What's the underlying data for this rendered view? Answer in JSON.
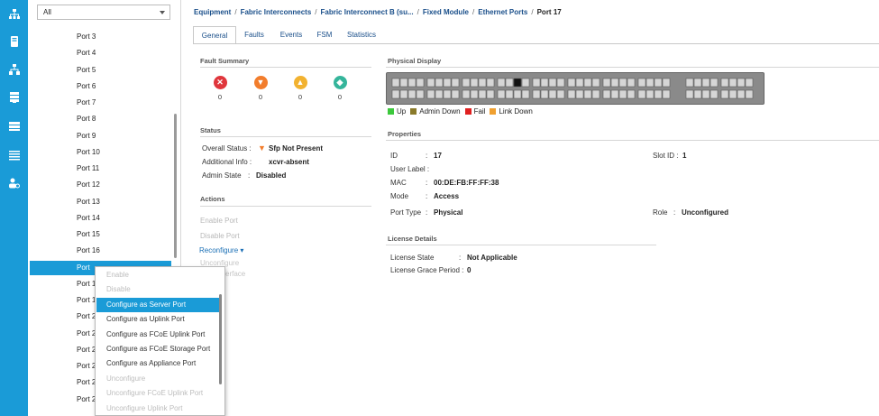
{
  "rail": {
    "items": [
      {
        "icon": "network-icon"
      },
      {
        "icon": "server-icon"
      },
      {
        "icon": "lan-icon"
      },
      {
        "icon": "storage-icon"
      },
      {
        "icon": "chassis-icon"
      },
      {
        "icon": "list-icon"
      },
      {
        "icon": "admin-icon"
      }
    ]
  },
  "tree": {
    "filter": "All",
    "ports": [
      "Port 3",
      "Port 4",
      "Port 5",
      "Port 6",
      "Port 7",
      "Port 8",
      "Port 9",
      "Port 10",
      "Port 11",
      "Port 12",
      "Port 13",
      "Port 14",
      "Port 15",
      "Port 16",
      "Port",
      "Port 1",
      "Port 1",
      "Port 2",
      "Port 2",
      "Port 2",
      "Port 2",
      "Port 2",
      "Port 2"
    ],
    "selected_index": 14
  },
  "breadcrumb": {
    "items": [
      "Equipment",
      "Fabric Interconnects",
      "Fabric Interconnect B (su...",
      "Fixed Module",
      "Ethernet Ports"
    ],
    "current": "Port 17",
    "separator": "/"
  },
  "tabs": [
    "General",
    "Faults",
    "Events",
    "FSM",
    "Statistics"
  ],
  "active_tab": "General",
  "fault_summary": {
    "title": "Fault Summary",
    "items": [
      {
        "icon": "critical-icon",
        "color": "#e0363c",
        "count": "0"
      },
      {
        "icon": "major-icon",
        "color": "#f27d2c",
        "count": "0"
      },
      {
        "icon": "minor-icon",
        "color": "#f2b230",
        "count": "0"
      },
      {
        "icon": "warning-icon",
        "color": "#35b59b",
        "count": "0"
      }
    ]
  },
  "status": {
    "title": "Status",
    "overall_label": "Overall Status :",
    "overall_value": "Sfp Not Present",
    "info_label": "Additional Info :",
    "info_value": "xcvr-absent",
    "admin_label": "Admin State",
    "admin_sep": ":",
    "admin_value": "Disabled"
  },
  "actions": {
    "title": "Actions",
    "enable": "Enable Port",
    "disable": "Disable Port",
    "reconfigure": "Reconfigure",
    "unconfigure": "Unconfigure",
    "interface_fragment": "erface"
  },
  "physical": {
    "title": "Physical Display",
    "legend": [
      {
        "label": "Up",
        "color": "#3cc83c"
      },
      {
        "label": "Admin Down",
        "color": "#8a7a2a"
      },
      {
        "label": "Fail",
        "color": "#e02020"
      },
      {
        "label": "Link Down",
        "color": "#f0a030"
      }
    ]
  },
  "properties": {
    "title": "Properties",
    "id_label": "ID",
    "id_sep": ":",
    "id_value": "17",
    "slot_label": "Slot ID :",
    "slot_value": "1",
    "user_label": "User Label :",
    "mac_label": "MAC",
    "mac_sep": ":",
    "mac_value": "00:DE:FB:FF:FF:38",
    "mode_label": "Mode",
    "mode_sep": ":",
    "mode_value": "Access",
    "porttype_label": "Port Type",
    "porttype_sep": ":",
    "porttype_value": "Physical",
    "role_label": "Role",
    "role_sep": ":",
    "role_value": "Unconfigured"
  },
  "license": {
    "title": "License Details",
    "state_label": "License State",
    "state_sep": ":",
    "state_value": "Not Applicable",
    "grace_label": "License Grace Period :",
    "grace_value": "0"
  },
  "context_menu": {
    "items": [
      {
        "label": "Enable",
        "state": "disabled"
      },
      {
        "label": "Disable",
        "state": "disabled"
      },
      {
        "label": "Configure as Server Port",
        "state": "highlight"
      },
      {
        "label": "Configure as Uplink Port",
        "state": "normal"
      },
      {
        "label": "Configure as FCoE Uplink Port",
        "state": "normal"
      },
      {
        "label": "Configure as FCoE Storage Port",
        "state": "normal"
      },
      {
        "label": "Configure as Appliance Port",
        "state": "normal"
      },
      {
        "label": "Unconfigure",
        "state": "disabled"
      },
      {
        "label": "Unconfigure FCoE Uplink Port",
        "state": "disabled"
      },
      {
        "label": "Unconfigure Uplink Port",
        "state": "disabled"
      }
    ]
  }
}
